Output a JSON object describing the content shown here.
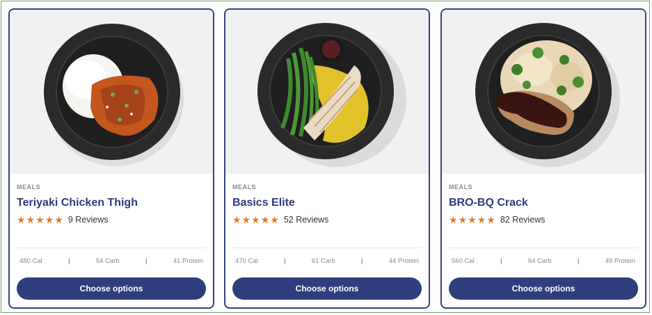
{
  "cards": [
    {
      "image_name": "teriyaki-chicken-plate-image",
      "category": "MEALS",
      "title": "Teriyaki Chicken Thigh",
      "rating_stars": 5,
      "reviews": "9 Reviews",
      "calories": "480 Cal",
      "carbs": "54 Carb",
      "protein": "41 Protein",
      "button_label": "Choose options"
    },
    {
      "image_name": "basics-elite-plate-image",
      "category": "MEALS",
      "title": "Basics Elite",
      "rating_stars": 5,
      "reviews": "52 Reviews",
      "calories": "470 Cal",
      "carbs": "61 Carb",
      "protein": "44 Protein",
      "button_label": "Choose options"
    },
    {
      "image_name": "bro-bq-crack-plate-image",
      "category": "MEALS",
      "title": "BRO-BQ Crack",
      "rating_stars": 5,
      "reviews": "82 Reviews",
      "calories": "560 Cal",
      "carbs": "64 Carb",
      "protein": "49 Protein",
      "button_label": "Choose options"
    }
  ],
  "star_glyph": "★",
  "separator": "|",
  "colors": {
    "accent": "#2f3f7e",
    "title": "#2e3c7e",
    "star": "#e8791e",
    "card_border": "#35417f"
  }
}
